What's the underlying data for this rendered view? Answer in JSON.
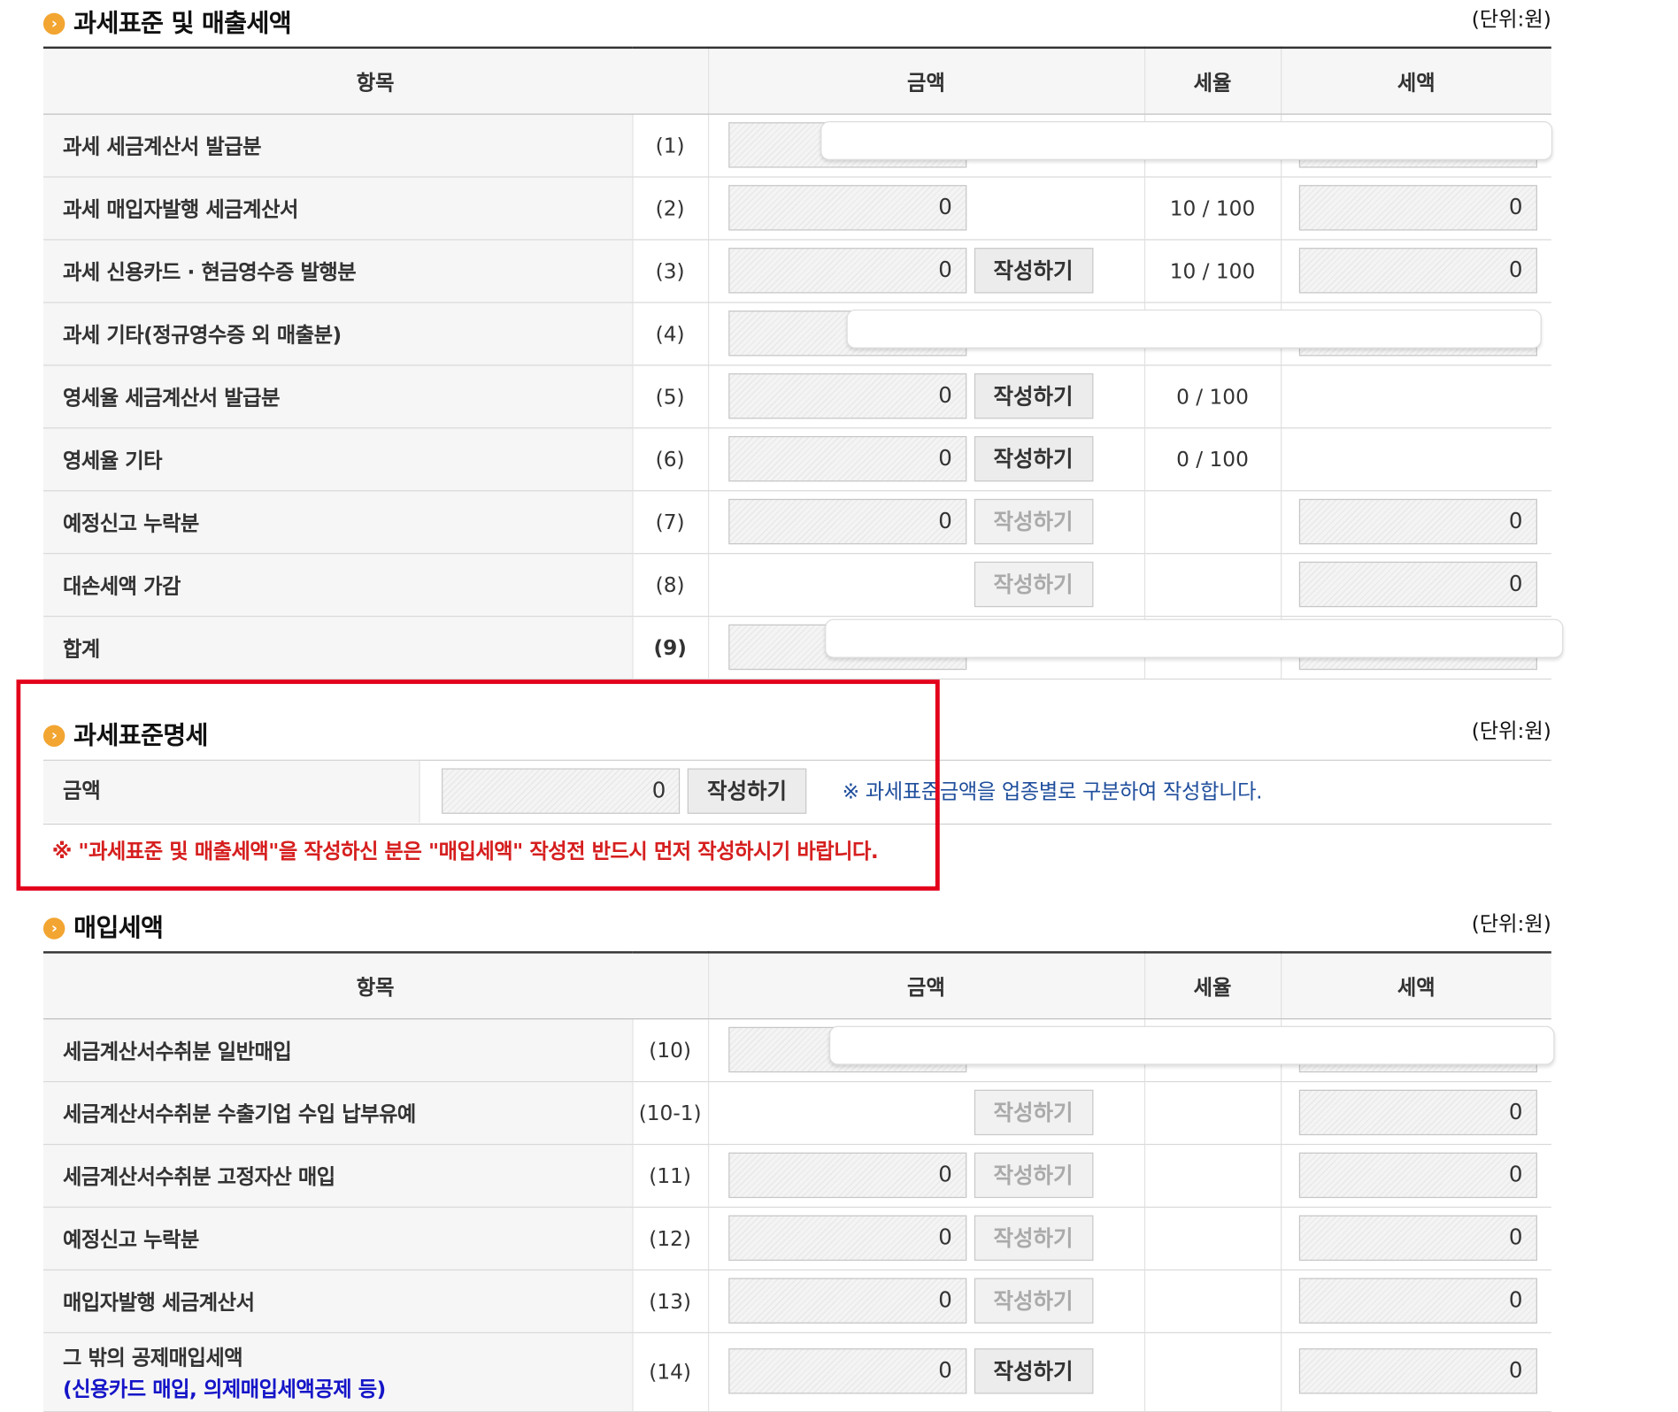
{
  "section1": {
    "title": "과세표준 및 매출세액",
    "unit": "(단위:원)",
    "headers": {
      "item": "항목",
      "amount": "금액",
      "rate": "세율",
      "tax": "세액"
    },
    "rows": [
      {
        "label": "과세 세금계산서 발급분",
        "num": "(1)"
      },
      {
        "label": "과세 매입자발행 세금계산서",
        "num": "(2)",
        "amount": "0",
        "rate": "10 / 100",
        "tax": "0"
      },
      {
        "label": "과세 신용카드 · 현금영수증 발행분",
        "num": "(3)",
        "amount": "0",
        "button": "작성하기",
        "rate": "10 / 100",
        "tax": "0"
      },
      {
        "label": "과세 기타(정규영수증 외 매출분)",
        "num": "(4)"
      },
      {
        "label": "영세율 세금계산서 발급분",
        "num": "(5)",
        "amount": "0",
        "button": "작성하기",
        "rate": "0 / 100"
      },
      {
        "label": "영세율 기타",
        "num": "(6)",
        "amount": "0",
        "button": "작성하기",
        "rate": "0 / 100"
      },
      {
        "label": "예정신고 누락분",
        "num": "(7)",
        "amount": "0",
        "button": "작성하기",
        "tax": "0"
      },
      {
        "label": "대손세액 가감",
        "num": "(8)",
        "button": "작성하기",
        "tax": "0"
      },
      {
        "label": "합계",
        "num": "(9)"
      }
    ]
  },
  "section2": {
    "title": "과세표준명세",
    "unit": "(단위:원)",
    "label": "금액",
    "amount": "0",
    "button": "작성하기",
    "note": "※ 과세표준금액을 업종별로 구분하여 작성합니다.",
    "warning": "※ \"과세표준 및 매출세액\"을 작성하신 분은 \"매입세액\" 작성전 반드시 먼저 작성하시기 바랍니다."
  },
  "section3": {
    "title": "매입세액",
    "unit": "(단위:원)",
    "headers": {
      "item": "항목",
      "amount": "금액",
      "rate": "세율",
      "tax": "세액"
    },
    "rows": [
      {
        "label": "세금계산서수취분 일반매입",
        "num": "(10)"
      },
      {
        "label": "세금계산서수취분 수출기업 수입 납부유예",
        "num": "(10-1)",
        "button": "작성하기",
        "tax": "0"
      },
      {
        "label": "세금계산서수취분 고정자산 매입",
        "num": "(11)",
        "amount": "0",
        "button": "작성하기",
        "tax": "0"
      },
      {
        "label": "예정신고 누락분",
        "num": "(12)",
        "amount": "0",
        "button": "작성하기",
        "tax": "0"
      },
      {
        "label": "매입자발행 세금계산서",
        "num": "(13)",
        "amount": "0",
        "button": "작성하기",
        "tax": "0"
      },
      {
        "label": "그 밖의 공제매입세액",
        "sublabel": "(신용카드 매입, 의제매입세액공제 등)",
        "num": "(14)",
        "amount": "0",
        "button": "작성하기",
        "tax": "0"
      }
    ]
  }
}
